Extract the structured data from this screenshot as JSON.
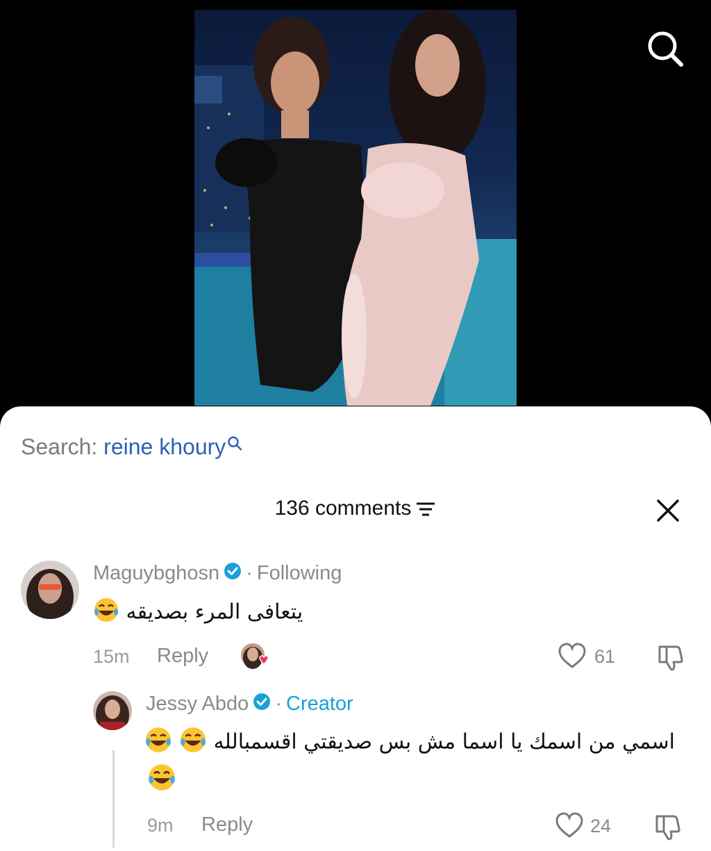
{
  "search": {
    "prefix": "Search: ",
    "term": "reine khoury"
  },
  "comments_header": {
    "count_label": "136 comments"
  },
  "comments": [
    {
      "username": "Maguybghosn",
      "badge": "Following",
      "text": "يتعافى المرء بصديقه",
      "time": "15m",
      "reply_label": "Reply",
      "likes": "61"
    },
    {
      "username": "Jessy Abdo",
      "badge": "Creator",
      "text": "اسمي من اسمك يا اسما مش بس صديقتي اقسمبالله",
      "time": "9m",
      "reply_label": "Reply",
      "likes": "24"
    }
  ],
  "colors": {
    "link": "#2f5fb3",
    "verified": "#1aa0d8",
    "creator": "#1aa0d8",
    "heart_badge": "#e8365d"
  },
  "icons": [
    "search-icon",
    "filter-icon",
    "close-icon",
    "verified-icon",
    "heart-icon",
    "dislike-icon",
    "laughing-emoji-icon"
  ]
}
